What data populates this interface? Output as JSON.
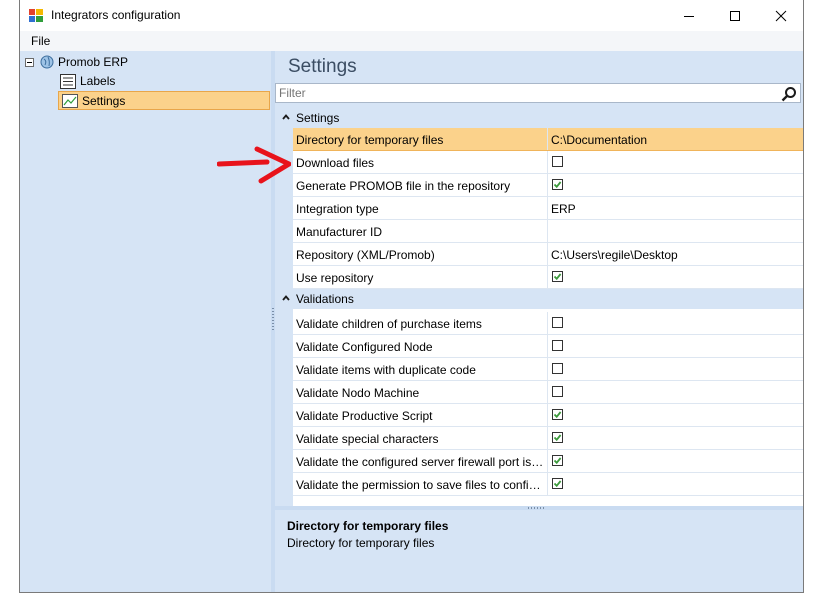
{
  "window": {
    "title": "Integrators configuration"
  },
  "menu": {
    "file": "File"
  },
  "tree": {
    "root": "Promob ERP",
    "items": [
      {
        "label": "Labels"
      },
      {
        "label": "Settings"
      }
    ]
  },
  "panel": {
    "title": "Settings",
    "filter_placeholder": "Filter",
    "categories": [
      {
        "label": "Settings",
        "rows": [
          {
            "name": "Directory for temporary files",
            "value": "C:\\Documentation"
          },
          {
            "name": "Download files",
            "checked": "false"
          },
          {
            "name": "Generate PROMOB file in the repository",
            "checked": "true"
          },
          {
            "name": "Integration type",
            "value": "ERP"
          },
          {
            "name": "Manufacturer ID",
            "value": ""
          },
          {
            "name": "Repository (XML/Promob)",
            "value": "C:\\Users\\regile\\Desktop"
          },
          {
            "name": "Use repository",
            "checked": "true"
          }
        ]
      },
      {
        "label": "Validations",
        "rows": [
          {
            "name": "Validate children of purchase items",
            "checked": "false"
          },
          {
            "name": "Validate Configured Node",
            "checked": "false"
          },
          {
            "name": "Validate items with duplicate code",
            "checked": "false"
          },
          {
            "name": "Validate Nodo Machine",
            "checked": "false"
          },
          {
            "name": "Validate Productive Script",
            "checked": "true"
          },
          {
            "name": "Validate special characters",
            "checked": "true"
          },
          {
            "name": "Validate the configured server firewall port is op...",
            "checked": "true"
          },
          {
            "name": "Validate the permission to save files to configure...",
            "checked": "true"
          }
        ]
      }
    ]
  },
  "description": {
    "title": "Directory for temporary files",
    "text": "Directory for temporary files"
  },
  "colors": {
    "selection": "#fbd28b",
    "panel": "#d6e4f5",
    "check": "#3c9a3c",
    "annotation_arrow": "#e8131b"
  }
}
